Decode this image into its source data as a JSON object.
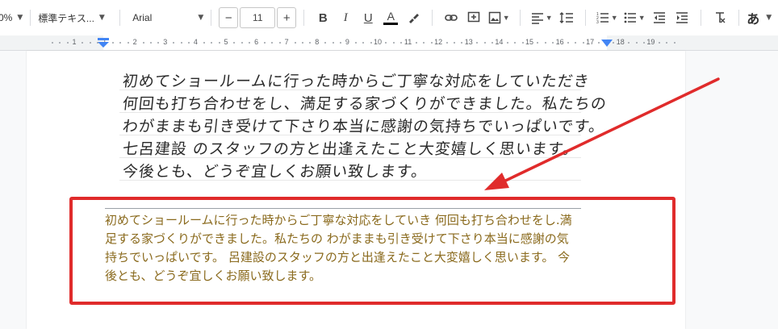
{
  "toolbar": {
    "zoom": "0%",
    "style_select": "標準テキス...",
    "font_select": "Arial",
    "minus": "−",
    "font_size": "11",
    "plus": "+",
    "bold": "B",
    "italic": "I",
    "underline": "U",
    "text_color": "A",
    "input_tool": "あ"
  },
  "ruler": {
    "ticks": [
      "1",
      "1",
      "2",
      "3",
      "4",
      "5",
      "6",
      "7",
      "8",
      "9",
      "10",
      "11",
      "12",
      "13",
      "14",
      "15",
      "16",
      "17",
      "18",
      "19"
    ]
  },
  "handwriting": {
    "lines": [
      "初めてショールームに行った時からご丁寧な対応をしていただき",
      "何回も打ち合わせをし、満足する家づくりができました。私たちの",
      "わがままも引き受けて下さり本当に感謝の気持ちでいっぱいです。",
      "七呂建設 のスタッフの方と出逢えたこと大変嬉しく思います。",
      "今後とも、どうぞ宜しくお願い致します。"
    ]
  },
  "transcription": {
    "lines": [
      "初めてショールームに行った時からご丁寧な対応をしていき 何回も打ち合わせをし.満",
      "足する家づくりができました。私たちの わがままも引き受けて下さり本当に感謝の気",
      "持ちでいっぱいです。 呂建設のスタッフの方と出逢えたこと大変嬉しく思います。 今",
      "後とも、どうぞ宜しくお願い致します。"
    ]
  },
  "colors": {
    "highlight_box": "#e02b2b",
    "transcription_text": "#8a6a1d",
    "ruler_marker": "#4285f4"
  }
}
